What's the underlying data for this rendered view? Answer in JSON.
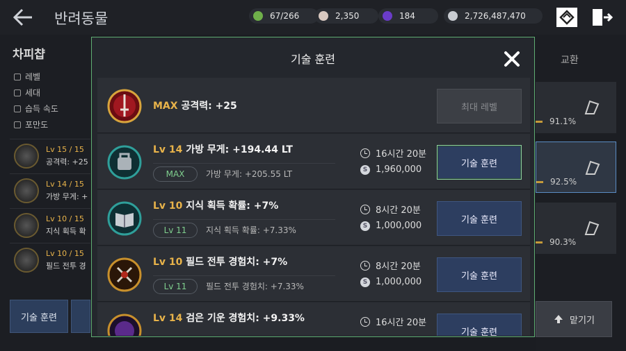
{
  "header": {
    "title": "반려동물",
    "resources": [
      {
        "icon": "energy-icon",
        "value": "67/266",
        "color": "#6fb04a"
      },
      {
        "icon": "pearl-icon",
        "value": "2,350",
        "color": "#d8c8c0"
      },
      {
        "icon": "dark-gem-icon",
        "value": "184",
        "color": "#6a3cc8"
      },
      {
        "icon": "silver-coin-icon",
        "value": "2,726,487,470",
        "color": "#c9ccd2"
      }
    ]
  },
  "pet": {
    "name": "차피챱",
    "stats": [
      "레벨",
      "세대",
      "습득 속도",
      "포만도"
    ],
    "skills": [
      {
        "level": "Lv 15 / 15",
        "desc": "공격력: +25"
      },
      {
        "level": "Lv 14 / 15",
        "desc": "가방 무게: +"
      },
      {
        "level": "Lv 10 / 15",
        "desc": "지식 획득 확"
      },
      {
        "level": "Lv 10 / 15",
        "desc": "필드 전투 경"
      }
    ],
    "train_button": "기술 훈련"
  },
  "right_panel": {
    "tab_exchange": "교환",
    "cards": [
      {
        "pct": "91.1%"
      },
      {
        "pct": "92.5%"
      },
      {
        "pct": "90.3%"
      }
    ],
    "entrust_button": "맡기기"
  },
  "modal": {
    "title": "기술 훈련",
    "rows": [
      {
        "level": "MAX",
        "name": "공격력: +25",
        "button": "최대 레벨",
        "icon": "sword-skill-icon"
      },
      {
        "level": "Lv 14",
        "name": "가방 무게: +194.44 LT",
        "next_level": "MAX",
        "next_value": "가방 무게: +205.55 LT",
        "time": "16시간 20분",
        "cost": "1,960,000",
        "button": "기술 훈련",
        "icon": "bag-weight-skill-icon"
      },
      {
        "level": "Lv 10",
        "name": "지식 획득 확률: +7%",
        "next_level": "Lv 11",
        "next_value": "지식 획득 확률: +7.33%",
        "time": "8시간 20분",
        "cost": "1,000,000",
        "button": "기술 훈련",
        "icon": "book-skill-icon"
      },
      {
        "level": "Lv 10",
        "name": "필드 전투 경험치: +7%",
        "next_level": "Lv 11",
        "next_value": "필드 전투 경험치: +7.33%",
        "time": "8시간 20분",
        "cost": "1,000,000",
        "button": "기술 훈련",
        "icon": "battle-exp-skill-icon"
      },
      {
        "level": "Lv 14",
        "name": "검은 기운 경험치: +9.33%",
        "time": "16시간 20분",
        "button": "기술 훈련",
        "icon": "dark-energy-skill-icon"
      }
    ]
  }
}
